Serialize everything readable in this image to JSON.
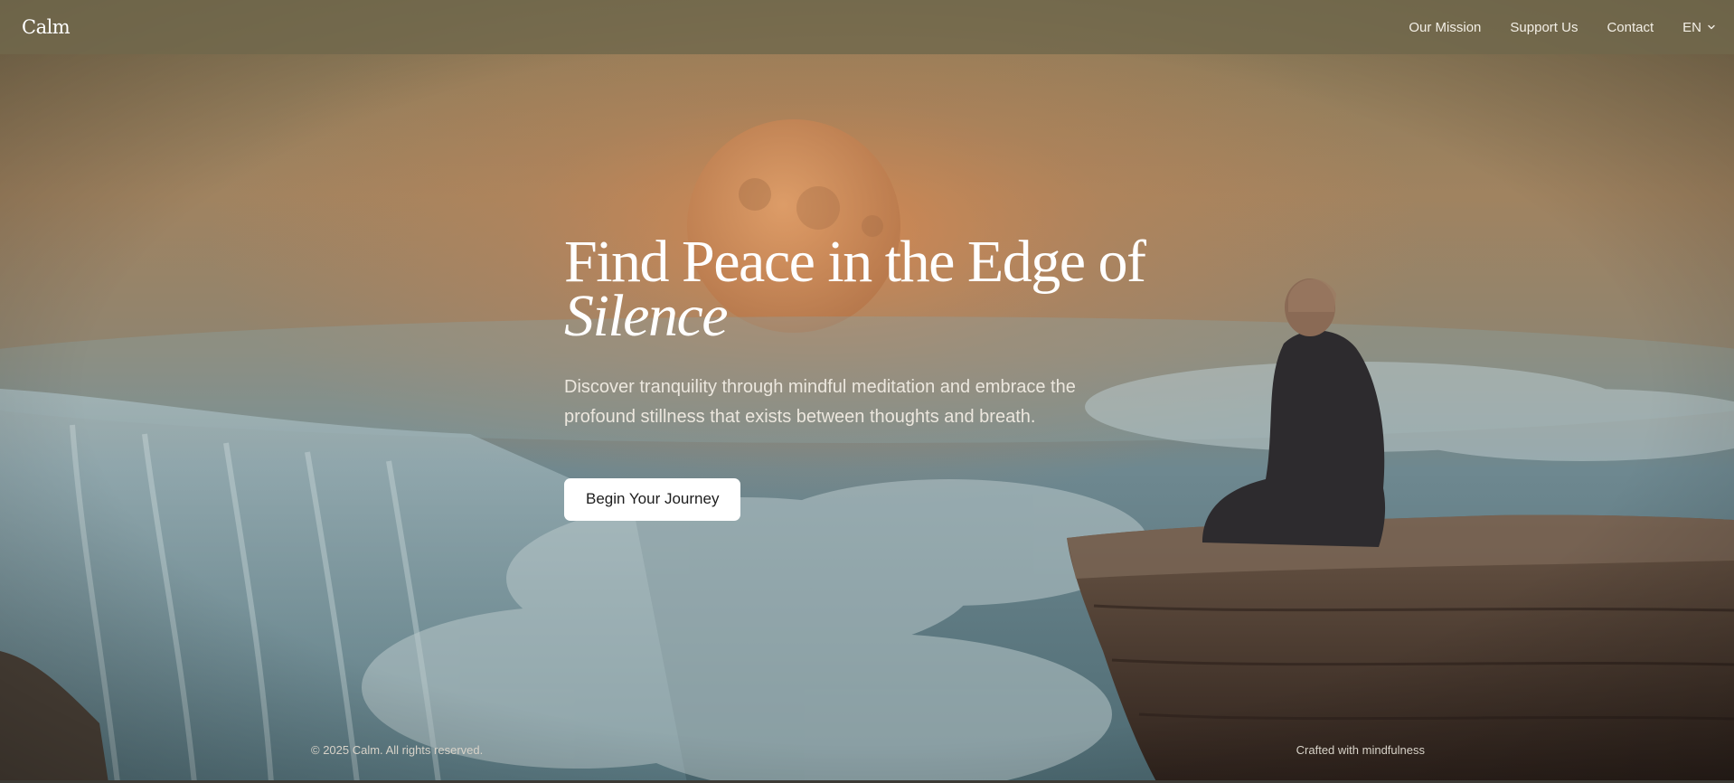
{
  "header": {
    "logo": "Calm",
    "nav": [
      {
        "label": "Our Mission"
      },
      {
        "label": "Support Us"
      },
      {
        "label": "Contact"
      }
    ],
    "language": "EN"
  },
  "hero": {
    "title_line1": "Find Peace in the Edge of",
    "title_line2": "Silence",
    "description": "Discover tranquility through mindful meditation and embrace the profound stillness that exists between thoughts and breath.",
    "cta_label": "Begin Your Journey"
  },
  "footer": {
    "copyright": "© 2025 Calm. All rights reserved.",
    "tagline": "Crafted with mindfulness"
  },
  "colors": {
    "header_bg": "#70684c",
    "sky_top": "#9c8a63",
    "sun_glow": "#d98a4e",
    "moon": "#c58a5a",
    "mist": "#7f9aa1",
    "cliff": "#4a3a30",
    "button_bg": "#ffffff"
  },
  "icons": {
    "language_caret": "chevron-down-icon"
  }
}
